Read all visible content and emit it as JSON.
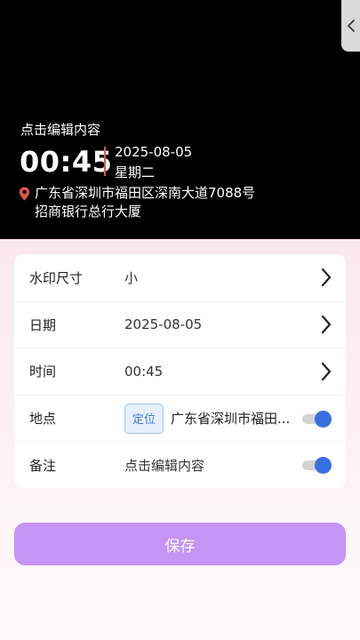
{
  "watermark": {
    "remark": "点击编辑内容",
    "time": "00:45",
    "date": "2025-08-05",
    "weekday": "星期二",
    "address_line1": "广东省深圳市福田区深南大道7088号",
    "address_line2": "招商银行总行大厦"
  },
  "colors": {
    "accent": "#c694f5",
    "toggle_on": "#3a6fe0",
    "divider": "#e0544e",
    "location_button": "#3f7ad3"
  },
  "settings": {
    "size": {
      "label": "水印尺寸",
      "value": "小"
    },
    "date": {
      "label": "日期",
      "value": "2025-08-05"
    },
    "time": {
      "label": "时间",
      "value": "00:45"
    },
    "location": {
      "label": "地点",
      "button": "定位",
      "value": "广东省深圳市福田...",
      "enabled": true
    },
    "remark": {
      "label": "备注",
      "value": "点击编辑内容",
      "enabled": true
    }
  },
  "icons": {
    "side_tab": "chevron-left-icon",
    "pin": "location-pin-icon",
    "row_arrow": "chevron-right-icon"
  },
  "actions": {
    "save_label": "保存"
  }
}
